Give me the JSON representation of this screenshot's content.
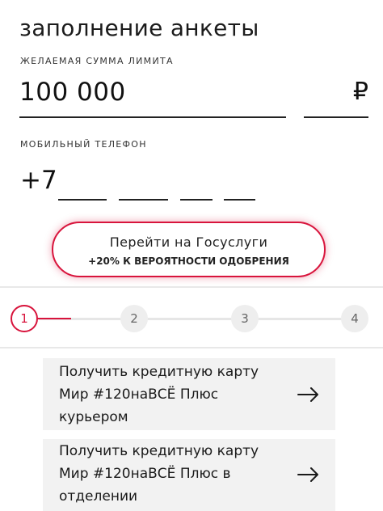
{
  "form": {
    "title": "заполнение анкеты",
    "amount_label": "ЖЕЛАЕМАЯ СУММА ЛИМИТА",
    "amount_value": "100 000",
    "currency_symbol": "₽",
    "phone_label": "МОБИЛЬНЫЙ ТЕЛЕФОН",
    "phone_prefix": "+7"
  },
  "gosuslugi": {
    "label": "Перейти на Госуслуги",
    "sublabel": "+20% К ВЕРОЯТНОСТИ ОДОБРЕНИЯ"
  },
  "stepper": {
    "steps": [
      "1",
      "2",
      "3",
      "4"
    ],
    "active_step": 1
  },
  "options": [
    {
      "text": "Получить кредитную карту Мир #120наВСЁ Плюс курьером",
      "icon": "arrow-right-icon"
    },
    {
      "text": "Получить кредитную карту Мир #120наВСЁ Плюс в отделении",
      "icon": "arrow-right-icon"
    }
  ],
  "colors": {
    "accent": "#d8143c",
    "card_background": "#f2f2f2",
    "text": "#1a1a1a",
    "step_inactive": "#eeeeee"
  }
}
